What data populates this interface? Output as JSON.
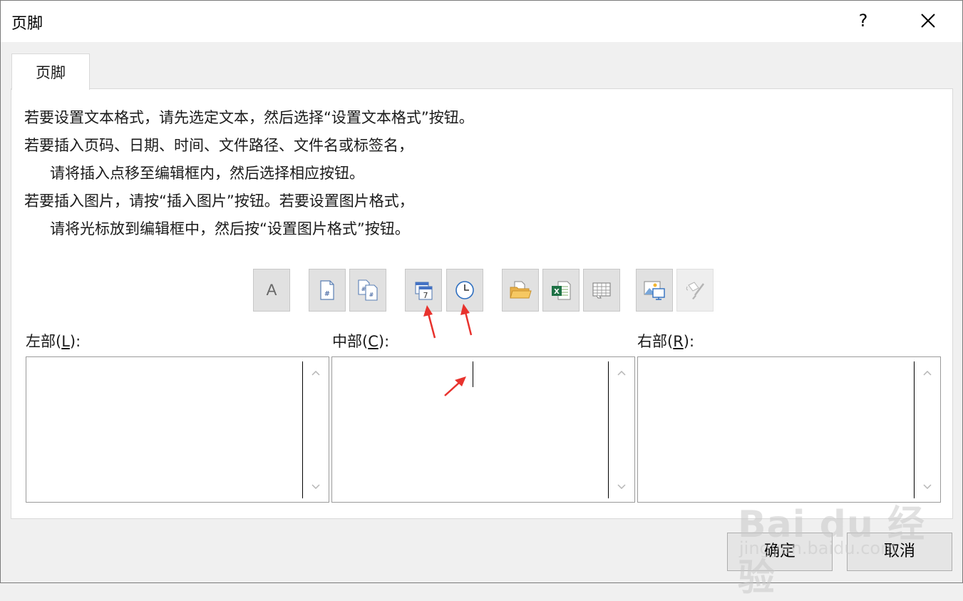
{
  "window": {
    "title": "页脚",
    "help_glyph": "?",
    "close_icon": "close-icon"
  },
  "tabs": [
    {
      "label": "页脚",
      "selected": true
    }
  ],
  "instructions": [
    "若要设置文本格式，请先选定文本，然后选择“设置文本格式”按钮。",
    "若要插入页码、日期、时间、文件路径、文件名或标签名，",
    "请将插入点移至编辑框内，然后选择相应按钮。",
    "若要插入图片，请按“插入图片”按钮。若要设置图片格式，",
    "请将光标放到编辑框中，然后按“设置图片格式”按钮。"
  ],
  "toolbar": {
    "format_text_glyph": "A",
    "buttons": [
      {
        "icon": "format-text-icon"
      },
      {
        "icon": "page-number-icon"
      },
      {
        "icon": "number-of-pages-icon"
      },
      {
        "icon": "date-icon"
      },
      {
        "icon": "time-icon"
      },
      {
        "icon": "file-path-icon"
      },
      {
        "icon": "file-name-icon"
      },
      {
        "icon": "sheet-name-icon"
      },
      {
        "icon": "insert-picture-icon"
      },
      {
        "icon": "format-picture-icon",
        "disabled": true
      }
    ]
  },
  "sections": {
    "left": {
      "label_prefix": "左部(",
      "accel": "L",
      "label_suffix": "):",
      "value": ""
    },
    "center": {
      "label_prefix": "中部(",
      "accel": "C",
      "label_suffix": "):",
      "value": ""
    },
    "right": {
      "label_prefix": "右部(",
      "accel": "R",
      "label_suffix": "):",
      "value": ""
    }
  },
  "buttons": {
    "ok": "确定",
    "cancel": "取消"
  },
  "watermark": {
    "big": "Bai du 经验",
    "small": "jingyan.baidu.com"
  },
  "colors": {
    "annotation_arrow": "#e8322d",
    "toolbar_button_bg": "#e1e1e1",
    "dialog_bg": "#f0f0f0"
  }
}
